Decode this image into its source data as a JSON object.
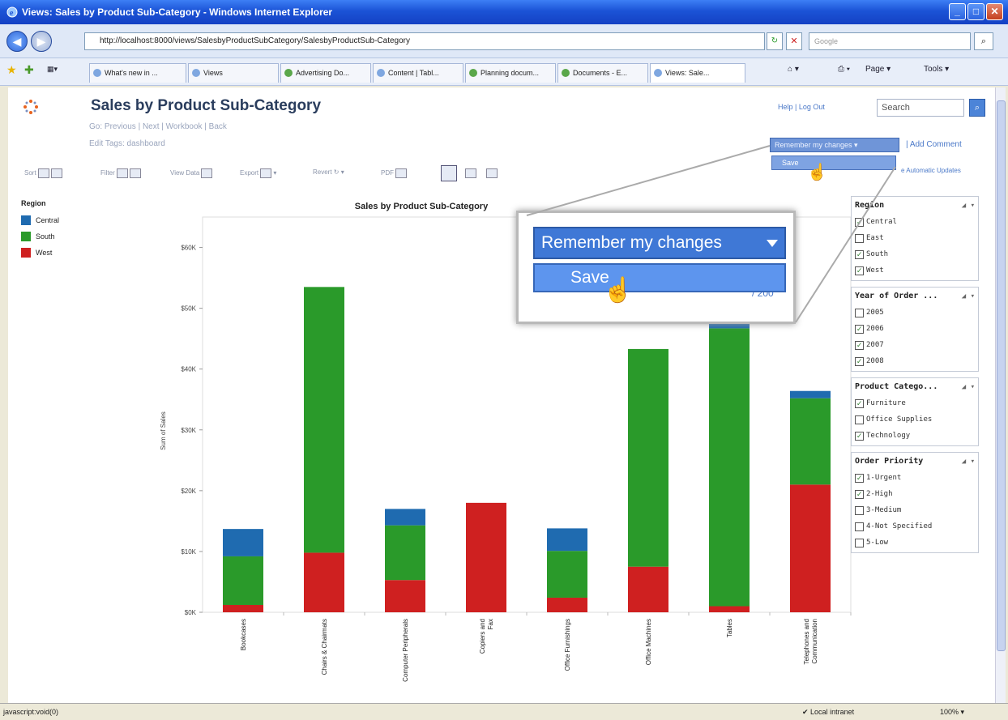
{
  "window": {
    "title": "Views: Sales by Product Sub-Category - Windows Internet Explorer"
  },
  "address": {
    "url": "http://localhost:8000/views/SalesbyProductSubCategory/SalesbyProductSub-Category",
    "search_placeholder": "Google"
  },
  "tabs": [
    {
      "label": "What's new in ..."
    },
    {
      "label": "Views"
    },
    {
      "label": "Advertising Do..."
    },
    {
      "label": "Content | Tabl..."
    },
    {
      "label": "Planning docum..."
    },
    {
      "label": "Documents - E..."
    },
    {
      "label": "Views: Sale..."
    }
  ],
  "browser_toolbar": {
    "page": "Page",
    "tools": "Tools"
  },
  "page": {
    "title": "Sales by Product Sub-Category",
    "sublinks": "Go: Previous | Next | Workbook | Back",
    "edit_tags": "Edit Tags: dashboard",
    "help": "Help",
    "logout": "Log Out",
    "search_placeholder": "Search",
    "remember_changes": "Remember my changes",
    "save": "Save",
    "add_comment": "Add Comment",
    "auto_updates": "e Automatic Updates"
  },
  "toolbar": {
    "sort": "Sort",
    "filter": "Filter",
    "view_data": "View Data",
    "export": "Export",
    "revert": "Revert",
    "pdf": "PDF"
  },
  "legend": {
    "title": "Region",
    "items": [
      {
        "label": "Central",
        "color": "#1f6bb0"
      },
      {
        "label": "South",
        "color": "#2a9a2a"
      },
      {
        "label": "West",
        "color": "#cf2020"
      }
    ]
  },
  "chart_data": {
    "type": "bar",
    "stacked": true,
    "title": "Sales by Product Sub-Category",
    "ylabel": "Sum of Sales",
    "xlabel": "",
    "ylim": [
      0,
      65000
    ],
    "yticks": [
      "$0K",
      "$10K",
      "$20K",
      "$30K",
      "$40K",
      "$50K",
      "$60K"
    ],
    "categories": [
      "Bookcases",
      "Chairs & Chairmats",
      "Computer Peripherals",
      "Copiers and Fax",
      "Office Furnishings",
      "Office Machines",
      "Tables",
      "Telephones and Communication"
    ],
    "series": [
      {
        "name": "West",
        "color": "#cf2020",
        "values": [
          1200,
          9800,
          5300,
          18000,
          2400,
          7500,
          1000,
          21000
        ]
      },
      {
        "name": "South",
        "color": "#2a9a2a",
        "values": [
          8000,
          43700,
          9000,
          0,
          7700,
          35800,
          45700,
          14200
        ]
      },
      {
        "name": "Central",
        "color": "#1f6bb0",
        "values": [
          4500,
          0,
          2700,
          0,
          3700,
          0,
          1000,
          1200
        ]
      }
    ]
  },
  "filters": [
    {
      "title": "Region",
      "items": [
        {
          "label": "Central",
          "checked": true
        },
        {
          "label": "East",
          "checked": false
        },
        {
          "label": "South",
          "checked": true
        },
        {
          "label": "West",
          "checked": true
        }
      ]
    },
    {
      "title": "Year of Order ...",
      "items": [
        {
          "label": "2005",
          "checked": false
        },
        {
          "label": "2006",
          "checked": true
        },
        {
          "label": "2007",
          "checked": true
        },
        {
          "label": "2008",
          "checked": true
        }
      ]
    },
    {
      "title": "Product Catego...",
      "items": [
        {
          "label": "Furniture",
          "checked": true
        },
        {
          "label": "Office Supplies",
          "checked": false
        },
        {
          "label": "Technology",
          "checked": true
        }
      ]
    },
    {
      "title": "Order Priority",
      "items": [
        {
          "label": "1-Urgent",
          "checked": true
        },
        {
          "label": "2-High",
          "checked": true
        },
        {
          "label": "3-Medium",
          "checked": false
        },
        {
          "label": "4-Not Specified",
          "checked": false
        },
        {
          "label": "5-Low",
          "checked": false
        }
      ]
    }
  ],
  "zoom_partial": "/ 200",
  "status": {
    "left": "javascript:void(0)",
    "zone": "Local intranet",
    "zoom": "100%"
  }
}
